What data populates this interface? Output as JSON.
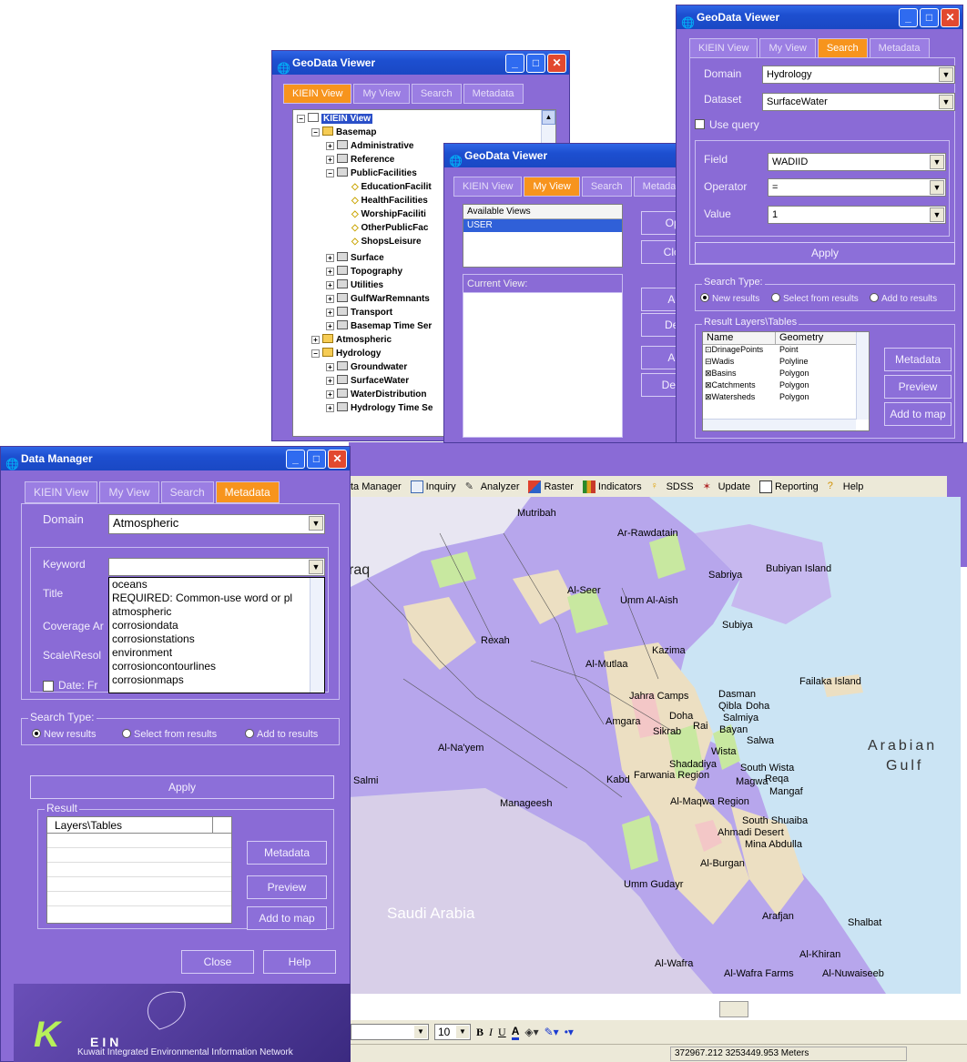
{
  "colors": {
    "window_bg": "#8a6bd6",
    "titlebar": "#1d4fd0",
    "active_tab": "#f7941d",
    "sea": "#cbe4f4"
  },
  "app_title": "GeoData Viewer",
  "tabs": [
    "KIEIN View",
    "My View",
    "Search",
    "Metadata"
  ],
  "tree": {
    "root": "KIEIN View",
    "nodes": [
      {
        "label": "Basemap",
        "icon": "folder-icon",
        "level": 1
      },
      {
        "label": "Administrative",
        "icon": "layer-group-icon",
        "level": 2
      },
      {
        "label": "Reference",
        "icon": "layer-group-icon",
        "level": 2
      },
      {
        "label": "PublicFacilities",
        "icon": "layer-group-icon",
        "level": 2
      },
      {
        "label": "EducationFacilit",
        "icon": "point-layer-icon",
        "level": 3
      },
      {
        "label": "HealthFacilities",
        "icon": "point-layer-icon",
        "level": 3
      },
      {
        "label": "WorshipFaciliti",
        "icon": "point-layer-icon",
        "level": 3
      },
      {
        "label": "OtherPublicFac",
        "icon": "point-layer-icon",
        "level": 3
      },
      {
        "label": "ShopsLeisure",
        "icon": "point-layer-icon",
        "level": 3
      },
      {
        "label": "Surface",
        "icon": "layer-group-icon",
        "level": 2
      },
      {
        "label": "Topography",
        "icon": "layer-group-icon",
        "level": 2
      },
      {
        "label": "Utilities",
        "icon": "layer-group-icon",
        "level": 2
      },
      {
        "label": "GulfWarRemnants",
        "icon": "layer-group-icon",
        "level": 2
      },
      {
        "label": "Transport",
        "icon": "layer-group-icon",
        "level": 2
      },
      {
        "label": "Basemap Time Ser",
        "icon": "layer-group-icon",
        "level": 2
      },
      {
        "label": "Atmospheric",
        "icon": "folder-icon",
        "level": 1
      },
      {
        "label": "Hydrology",
        "icon": "folder-icon",
        "level": 1
      },
      {
        "label": "Groundwater",
        "icon": "layer-group-icon",
        "level": 2
      },
      {
        "label": "SurfaceWater",
        "icon": "layer-group-icon",
        "level": 2
      },
      {
        "label": "WaterDistribution",
        "icon": "layer-group-icon",
        "level": 2
      },
      {
        "label": "Hydrology Time Se",
        "icon": "layer-group-icon",
        "level": 2
      }
    ]
  },
  "myview": {
    "available_header": "Available Views",
    "available_item": "USER",
    "current_header": "Current View:",
    "buttons": [
      "Oper",
      "Close",
      "Add",
      "Delet",
      "Add",
      "Delete"
    ]
  },
  "search": {
    "domain_label": "Domain",
    "domain_value": "Hydrology",
    "dataset_label": "Dataset",
    "dataset_value": "SurfaceWater",
    "use_query": "Use query",
    "field_label": "Field",
    "field_value": "WADIID",
    "operator_label": "Operator",
    "operator_value": "=",
    "value_label": "Value",
    "value_value": "1",
    "apply": "Apply",
    "search_type": "Search Type:",
    "radios": [
      "New results",
      "Select from results",
      "Add to results"
    ],
    "result_group": "Result Layers\\Tables",
    "columns": [
      "Name",
      "Geometry"
    ],
    "rows": [
      {
        "name": "DrinagePoints",
        "geometry": "Point"
      },
      {
        "name": "Wadis",
        "geometry": "Polyline"
      },
      {
        "name": "Basins",
        "geometry": "Polygon"
      },
      {
        "name": "Catchments",
        "geometry": "Polygon"
      },
      {
        "name": "Watersheds",
        "geometry": "Polygon"
      }
    ],
    "side_buttons": [
      "Metadata",
      "Preview",
      "Add to map"
    ]
  },
  "data_manager": {
    "title": "Data Manager",
    "domain_label": "Domain",
    "domain_value": "Atmospheric",
    "keyword_label": "Keyword",
    "keyword_value": "",
    "title_label": "Title",
    "coverage_label": "Coverage Ar",
    "scale_label": "Scale\\Resol",
    "date_label": "Date:  Fr",
    "keyword_options": [
      "oceans",
      "REQUIRED: Common-use word or pl",
      "atmospheric",
      "corrosiondata",
      "corrosionstations",
      "environment",
      "corrosioncontourlines",
      "corrosionmaps"
    ],
    "search_type": "Search Type:",
    "radios": [
      "New results",
      "Select from results",
      "Add to results"
    ],
    "apply": "Apply",
    "result_label": "Result",
    "result_column": "Layers\\Tables",
    "side_buttons": [
      "Metadata",
      "Preview",
      "Add to map"
    ],
    "close": "Close",
    "help": "Help",
    "logo_text": "EIN",
    "logo_k": "K",
    "network_name": "Kuwait Integrated Environmental Information Network"
  },
  "toolbar": [
    {
      "label": "ta Manager",
      "icon": ""
    },
    {
      "label": "Inquiry",
      "icon": "inquiry-icon"
    },
    {
      "label": "Analyzer",
      "icon": "analyzer-icon"
    },
    {
      "label": "Raster",
      "icon": "raster-icon"
    },
    {
      "label": "Indicators",
      "icon": "indicators-icon"
    },
    {
      "label": "SDSS",
      "icon": "sdss-icon"
    },
    {
      "label": "Update",
      "icon": "update-icon"
    },
    {
      "label": "Reporting",
      "icon": "reporting-icon"
    },
    {
      "label": "Help",
      "icon": "help-icon"
    }
  ],
  "map_labels": {
    "iraq": "raq",
    "arabian_gulf_1": "Arabian",
    "arabian_gulf_2": "Gulf",
    "saudi": "Saudi Arabia",
    "places": [
      "Mutribah",
      "Ar-Rawdatain",
      "Sabriya",
      "Bubiyan Island",
      "Al-Seer",
      "Umm Al-Aish",
      "Subiya",
      "Rexah",
      "Kazima",
      "Al-Mutlaa",
      "Failaka Island",
      "Dasman",
      "Qibla",
      "Doha",
      "Jahra Camps",
      "Doha",
      "Salmiya",
      "Amgara",
      "Sikrab",
      "Rai",
      "Bayan",
      "Al-Na'yem",
      "Wista",
      "Salwa",
      "Shadadiya",
      "South Wista",
      "Kabd",
      "Farwania Region",
      "Magwa",
      "Reqa",
      "Salmi",
      "Mangaf",
      "Manageesh",
      "Al-Maqwa Region",
      "South Shuaiba",
      "Ahmadi Desert",
      "Mina Abdulla",
      "Al-Burgan",
      "Umm Gudayr",
      "Arafjan",
      "Shalbat",
      "Al-Khiran",
      "Al-Wafra",
      "Al-Wafra Farms",
      "Al-Nuwaiseeb"
    ]
  },
  "format_bar": {
    "size": "10",
    "bold": "B",
    "italic": "I",
    "underline": "U",
    "font_a": "A"
  },
  "status": {
    "coords": "372967.212  3253449.953 Meters"
  }
}
